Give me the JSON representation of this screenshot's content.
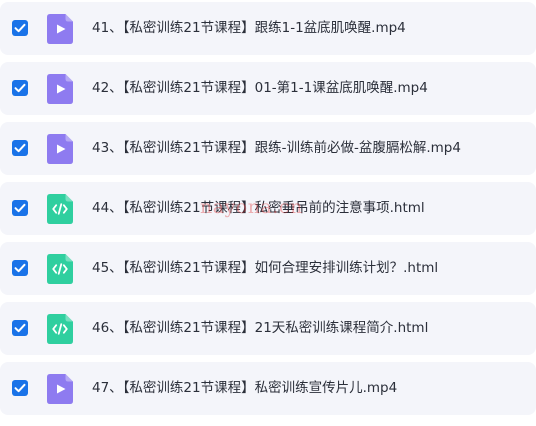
{
  "colors": {
    "row_background": "#f4f5fa",
    "checkbox_checked": "#1a73e8",
    "video_icon": "#8e7bf0",
    "code_icon": "#2fcf9f",
    "text": "#2b2f3a",
    "watermark": "#dc2828"
  },
  "files": [
    {
      "number": "41、",
      "name": "【私密训练21节课程】跟练1-1盆底肌唤醒.mp4",
      "type": "video",
      "icon": "play-file-icon",
      "checked": true
    },
    {
      "number": "42、",
      "name": "【私密训练21节课程】01-第1-1课盆底肌唤醒.mp4",
      "type": "video",
      "icon": "play-file-icon",
      "checked": true
    },
    {
      "number": "43、",
      "name": "【私密训练21节课程】跟练-训练前必做-盆腹膈松解.mp4",
      "type": "video",
      "icon": "play-file-icon",
      "checked": true
    },
    {
      "number": "44、",
      "name": "【私密训练21节课程】私密垂吊前的注意事项.html",
      "type": "code",
      "icon": "code-file-icon",
      "checked": true
    },
    {
      "number": "45、",
      "name": "【私密训练21节课程】如何合理安排训练计划？.html",
      "type": "code",
      "icon": "code-file-icon",
      "checked": true
    },
    {
      "number": "46、",
      "name": "【私密训练21节课程】21天私密训练课程简介.html",
      "type": "code",
      "icon": "code-file-icon",
      "checked": true
    },
    {
      "number": "47、",
      "name": "【私密训练21节课程】私密训练宣传片儿.mp4",
      "type": "video",
      "icon": "play-file-icon",
      "checked": true
    }
  ],
  "watermark": "nayona.cn"
}
